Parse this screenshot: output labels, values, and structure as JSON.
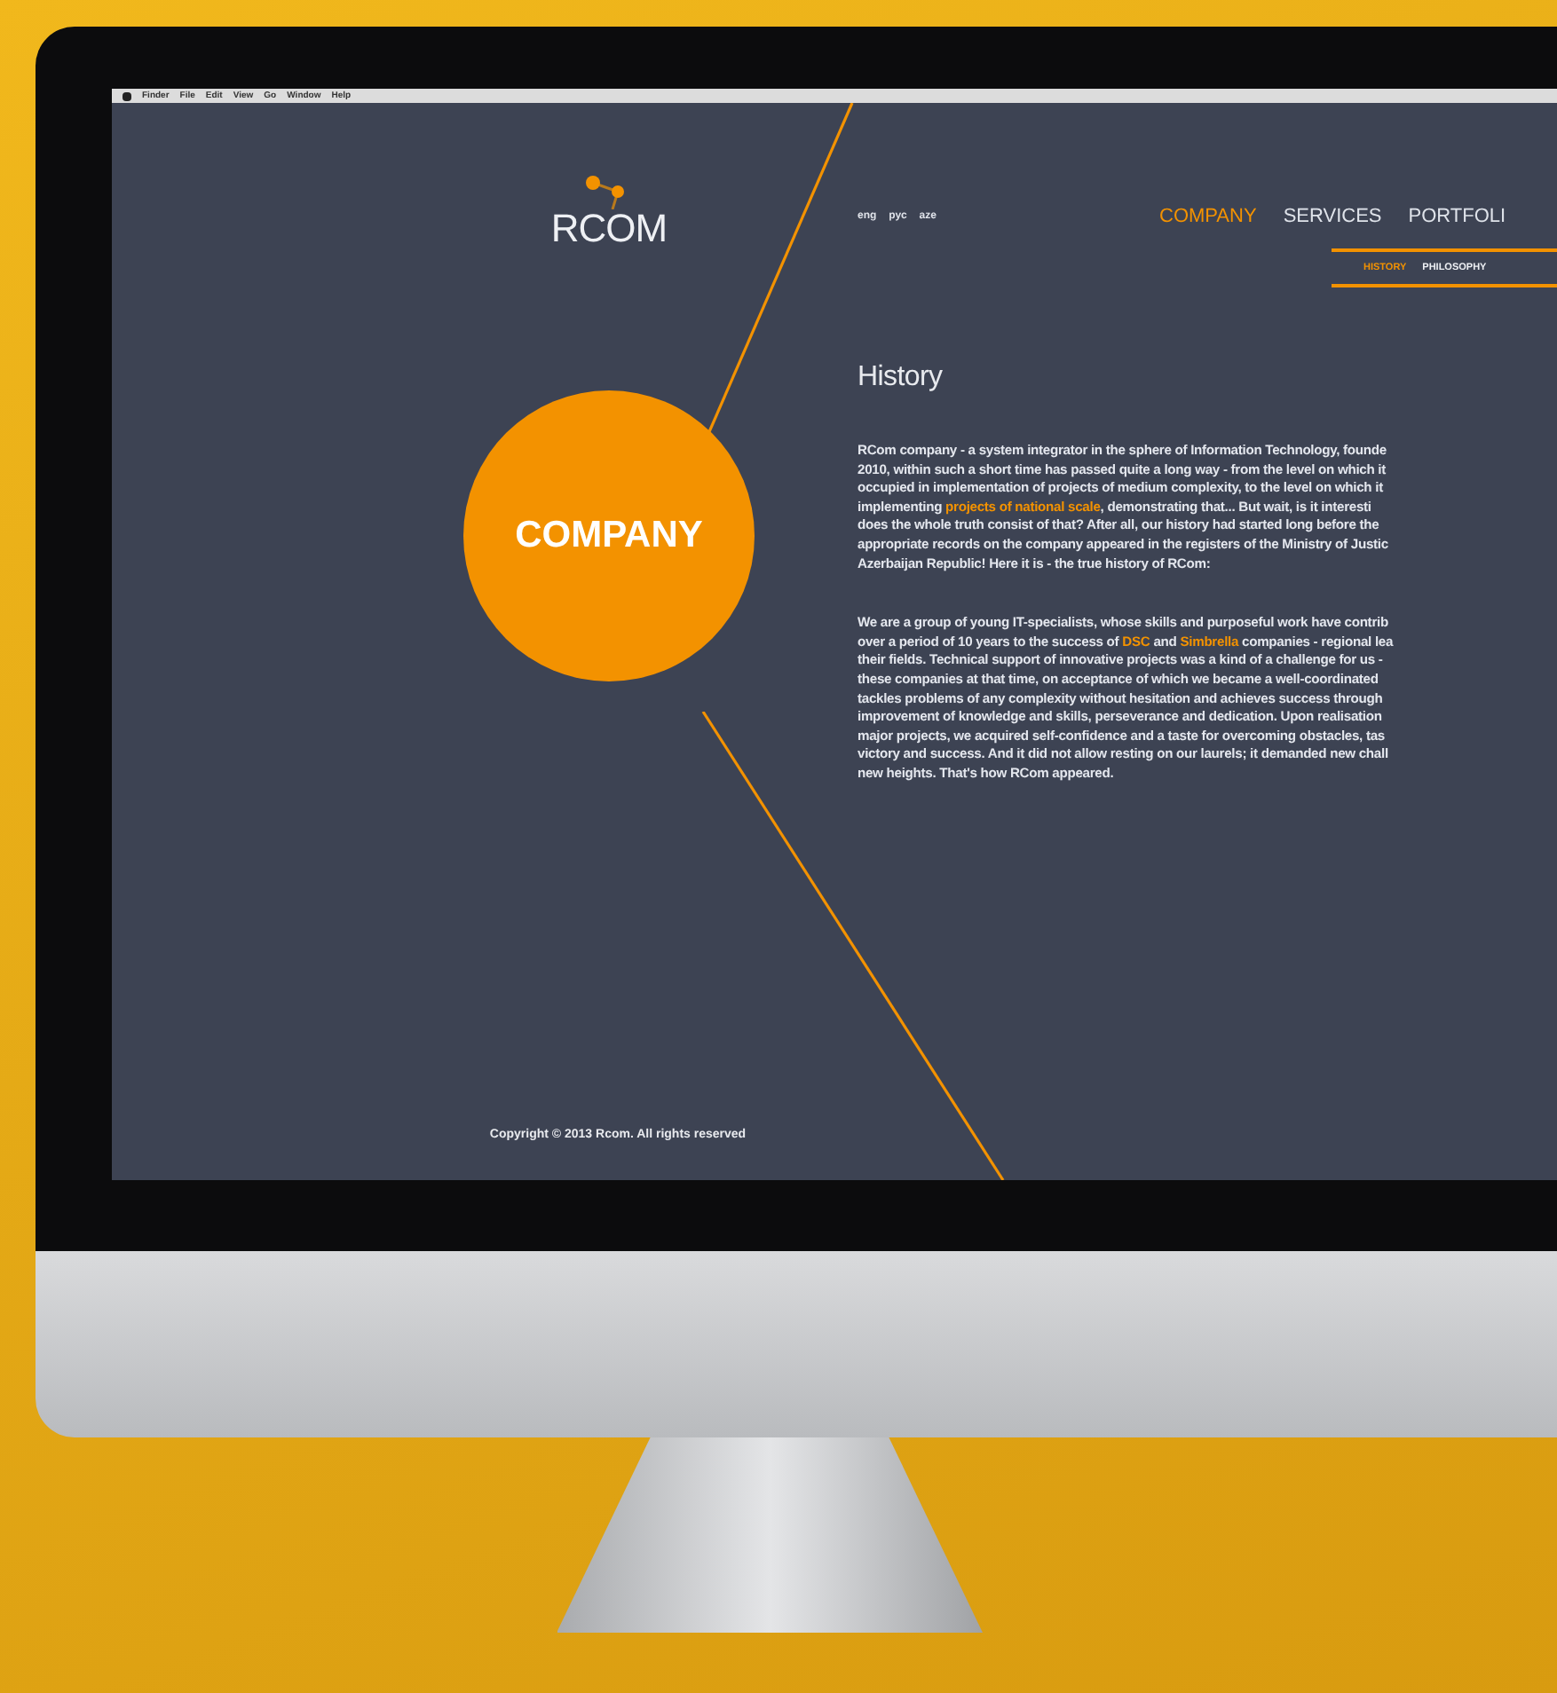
{
  "menu_bar": {
    "items": [
      "Finder",
      "File",
      "Edit",
      "View",
      "Go",
      "Window",
      "Help"
    ]
  },
  "logo": {
    "text": "RCOM"
  },
  "languages": [
    "eng",
    "рус",
    "aze"
  ],
  "nav": [
    {
      "label": "COMPANY",
      "selected": true
    },
    {
      "label": "SERVICES",
      "selected": false
    },
    {
      "label": "PORTFOLI",
      "selected": false
    }
  ],
  "subnav": [
    {
      "label": "HISTORY",
      "selected": true
    },
    {
      "label": "PHILOSOPHY",
      "selected": false
    }
  ],
  "section_badge": "COMPANY",
  "heading": "History",
  "paragraphs": [
    [
      [
        {
          "text": "RCom company - a system integrator in the sphere of Information Technology, founde",
          "highlight": false
        }
      ],
      [
        {
          "text": "2010, within such a short time has passed quite a long way - from the level on which it",
          "highlight": false
        }
      ],
      [
        {
          "text": "occupied in implementation of projects of medium complexity, to the level on which it",
          "highlight": false
        }
      ],
      [
        {
          "text": "implementing ",
          "highlight": false
        },
        {
          "text": "projects of national scale",
          "highlight": true
        },
        {
          "text": ", demonstrating that... But wait, is it interesti",
          "highlight": false
        }
      ],
      [
        {
          "text": "does the whole truth consist of that? After all, our history had started long before the",
          "highlight": false
        }
      ],
      [
        {
          "text": "appropriate records on the company appeared in the registers of the Ministry of Justic",
          "highlight": false
        }
      ],
      [
        {
          "text": "Azerbaijan Republic! Here it is - the true history of RCom:",
          "highlight": false
        }
      ]
    ],
    [
      [
        {
          "text": "We are a group of young IT-specialists, whose skills and purposeful work have contrib",
          "highlight": false
        }
      ],
      [
        {
          "text": "over a period of 10 years to the success of ",
          "highlight": false
        },
        {
          "text": "DSC",
          "highlight": true
        },
        {
          "text": " and ",
          "highlight": false
        },
        {
          "text": "Simbrella",
          "highlight": true
        },
        {
          "text": " companies - regional lea",
          "highlight": false
        }
      ],
      [
        {
          "text": "their fields. Technical support of innovative projects was a kind of a challenge for us -",
          "highlight": false
        }
      ],
      [
        {
          "text": "these companies at that time, on acceptance of which we became a well-coordinated",
          "highlight": false
        }
      ],
      [
        {
          "text": "tackles problems of any complexity without hesitation and achieves success through",
          "highlight": false
        }
      ],
      [
        {
          "text": "improvement of knowledge and skills, perseverance and dedication. Upon realisation",
          "highlight": false
        }
      ],
      [
        {
          "text": "major projects, we acquired self-confidence and a taste for overcoming obstacles, tas",
          "highlight": false
        }
      ],
      [
        {
          "text": "victory and success. And it did not allow resting on our laurels; it demanded new chall",
          "highlight": false
        }
      ],
      [
        {
          "text": "new heights. That's how RCom appeared.",
          "highlight": false
        }
      ]
    ]
  ],
  "copyright": "Copyright © 2013 Rcom. All rights reserved"
}
